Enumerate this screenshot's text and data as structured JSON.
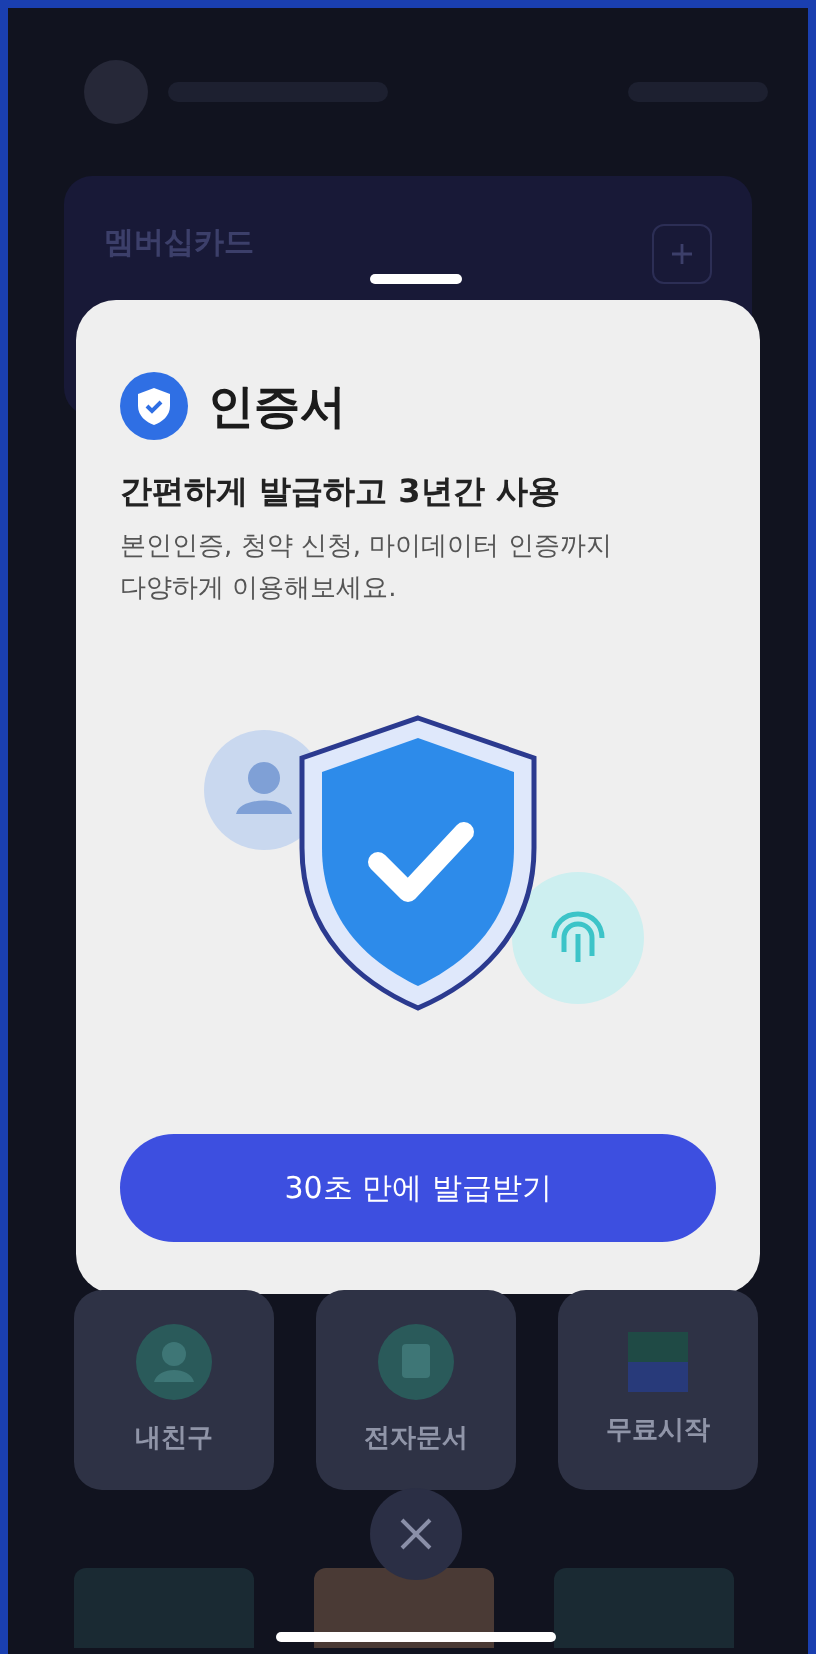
{
  "background": {
    "card_title": "멤버십카드",
    "tiles": [
      {
        "kind": "person",
        "title": "내친구"
      },
      {
        "kind": "document",
        "title": "전자문서"
      },
      {
        "kind": "badge",
        "title": "무료시작"
      }
    ]
  },
  "sheet": {
    "title": "인증서",
    "headline": "간편하게 발급하고 3년간 사용",
    "body": [
      "본인인증, 청약 신청, 마이데이터 인증까지",
      "다양하게 이용해보세요."
    ],
    "button": "30초 만에 발급받기"
  }
}
